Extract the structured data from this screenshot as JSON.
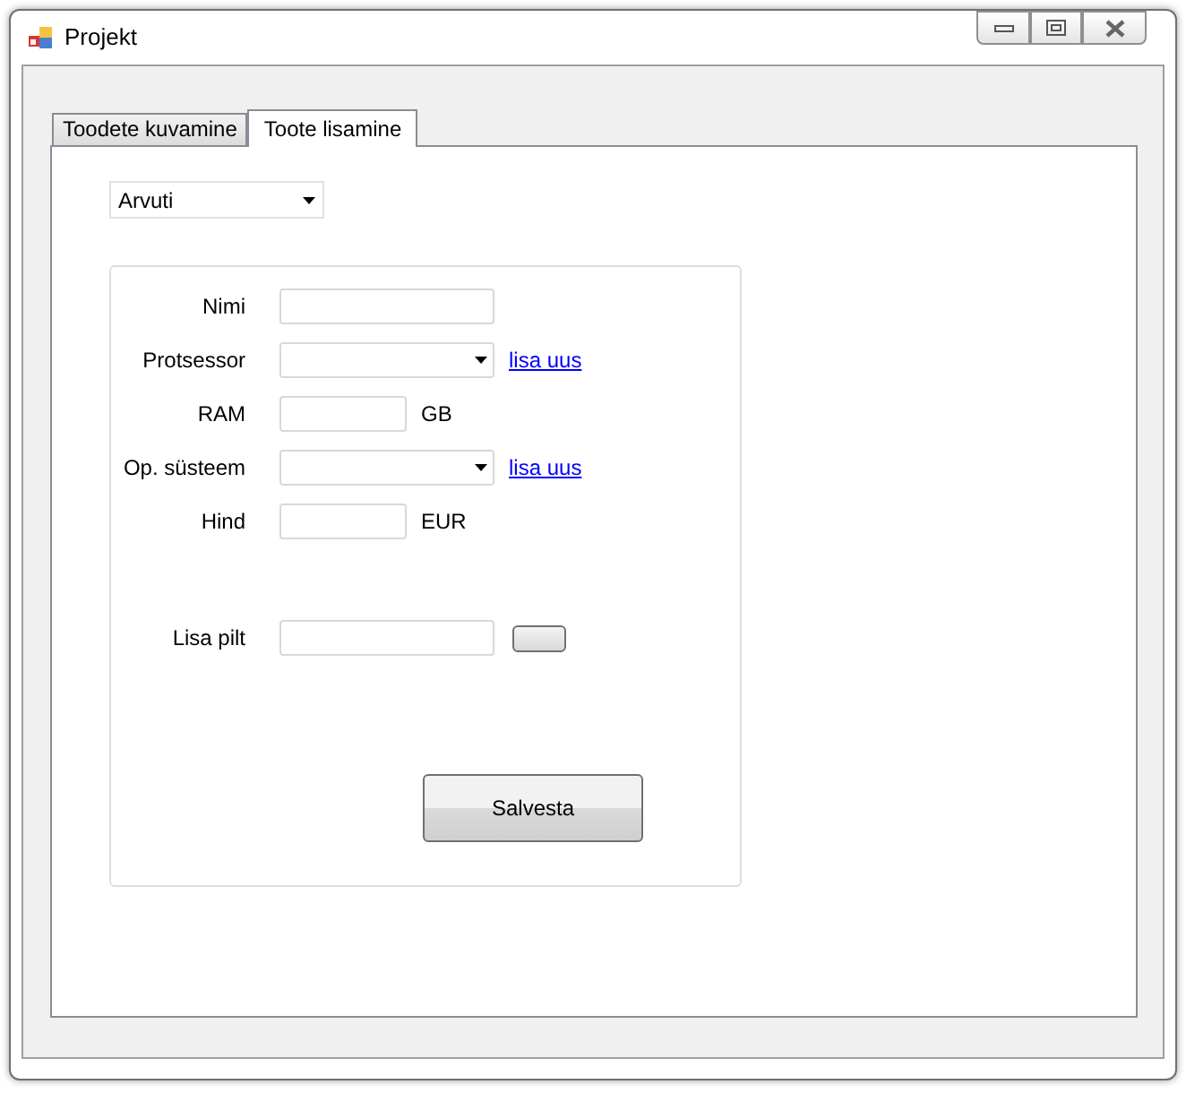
{
  "window": {
    "title": "Projekt"
  },
  "tabs": [
    {
      "label": "Toodete kuvamine",
      "selected": false
    },
    {
      "label": "Toote lisamine",
      "selected": true
    }
  ],
  "category_select": {
    "value": "Arvuti"
  },
  "form": {
    "fields": [
      {
        "kind": "text",
        "label": "Nimi"
      },
      {
        "kind": "combo",
        "label": "Protsessor",
        "link": "lisa uus"
      },
      {
        "kind": "unit",
        "label": "RAM",
        "unit": "GB"
      },
      {
        "kind": "combo",
        "label": "Op. süsteem",
        "link": "lisa uus"
      },
      {
        "kind": "unit",
        "label": "Hind",
        "unit": "EUR"
      },
      {
        "kind": "file",
        "label": "Lisa pilt"
      }
    ],
    "save_button": "Salvesta"
  }
}
